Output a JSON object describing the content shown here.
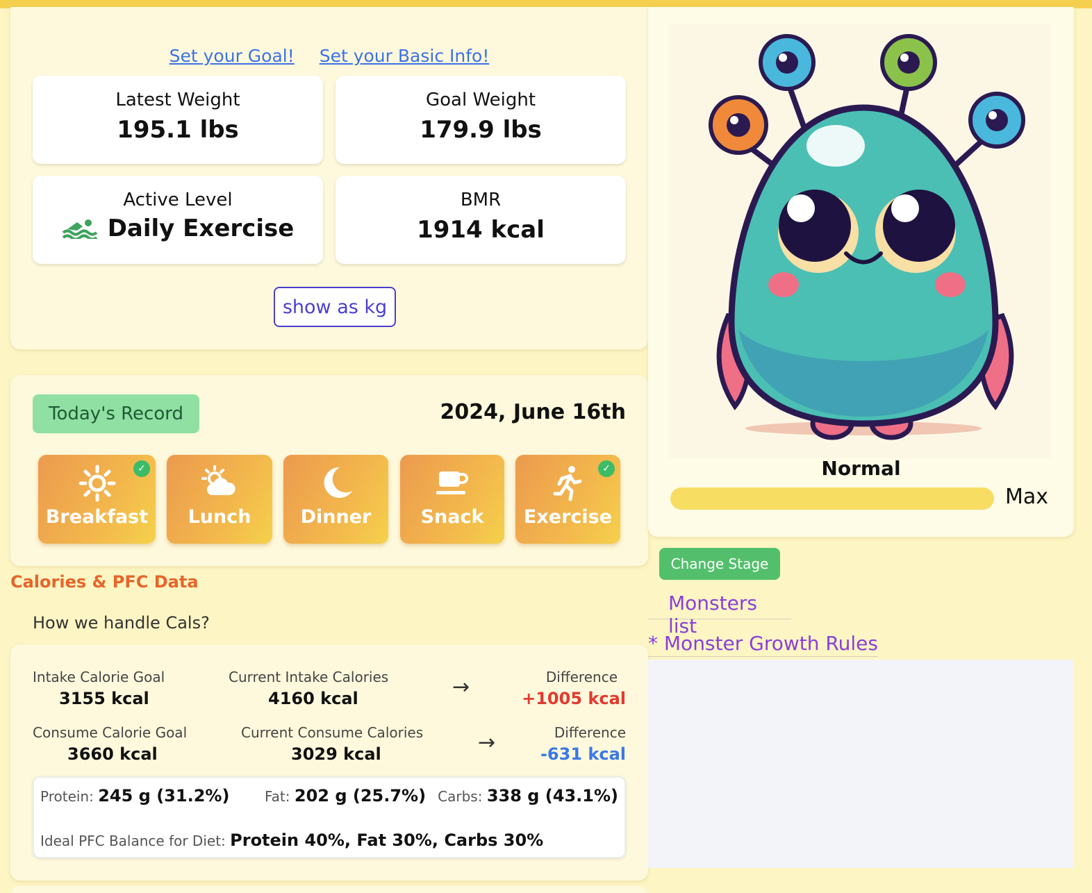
{
  "links": {
    "set_goal": "Set your Goal!",
    "set_basic_info": "Set your Basic Info!"
  },
  "stats": {
    "latest_weight": {
      "label": "Latest Weight",
      "value": "195.1 lbs"
    },
    "goal_weight": {
      "label": "Goal Weight",
      "value": "179.9 lbs"
    },
    "active_level": {
      "label": "Active Level",
      "value": "Daily Exercise",
      "icon": "swimming-icon"
    },
    "bmr": {
      "label": "BMR",
      "value": "1914 kcal"
    }
  },
  "unit_toggle": "show as kg",
  "record": {
    "badge": "Today's Record",
    "date": "2024, June 16th",
    "buttons": [
      {
        "label": "Breakfast",
        "icon": "sun-icon",
        "done": true
      },
      {
        "label": "Lunch",
        "icon": "partly-cloudy-icon",
        "done": false
      },
      {
        "label": "Dinner",
        "icon": "moon-icon",
        "done": false
      },
      {
        "label": "Snack",
        "icon": "coffee-cup-icon",
        "done": false
      },
      {
        "label": "Exercise",
        "icon": "running-icon",
        "done": true
      }
    ]
  },
  "calories": {
    "heading": "Calories & PFC Data",
    "help_link": "How we handle Cals?",
    "intake_goal": {
      "label": "Intake Calorie Goal",
      "value": "3155 kcal"
    },
    "current_intake": {
      "label": "Current Intake Calories",
      "value": "4160 kcal"
    },
    "intake_diff": {
      "label": "Difference",
      "value": "+1005 kcal"
    },
    "consume_goal": {
      "label": "Consume Calorie Goal",
      "value": "3660 kcal"
    },
    "current_consume": {
      "label": "Current Consume Calories",
      "value": "3029 kcal"
    },
    "consume_diff": {
      "label": "Difference",
      "value": "-631 kcal"
    },
    "arrow": "→",
    "pfc": {
      "protein_label": "Protein:",
      "protein_value": "245 g (31.2%)",
      "fat_label": "Fat:",
      "fat_value": "202 g (25.7%)",
      "carbs_label": "Carbs:",
      "carbs_value": "338 g (43.1%)",
      "ideal_label": "Ideal PFC Balance for Diet:",
      "ideal_value": "Protein 40%, Fat 30%, Carbs 30%"
    }
  },
  "monster": {
    "stage": "Normal",
    "progress_fraction": 1.0,
    "progress_max_label": "Max",
    "change_stage": "Change Stage",
    "monsters_list": "Monsters list",
    "growth_rules": "* Monster Growth Rules"
  },
  "colors": {
    "background": "#fdf5c4",
    "accent_orange": "#e5662b",
    "link_blue": "#3b72e6",
    "purple_link": "#8a3fd8",
    "green_button": "#53bf6c",
    "red_diff": "#e23a2f",
    "blue_diff": "#3a78e6"
  }
}
